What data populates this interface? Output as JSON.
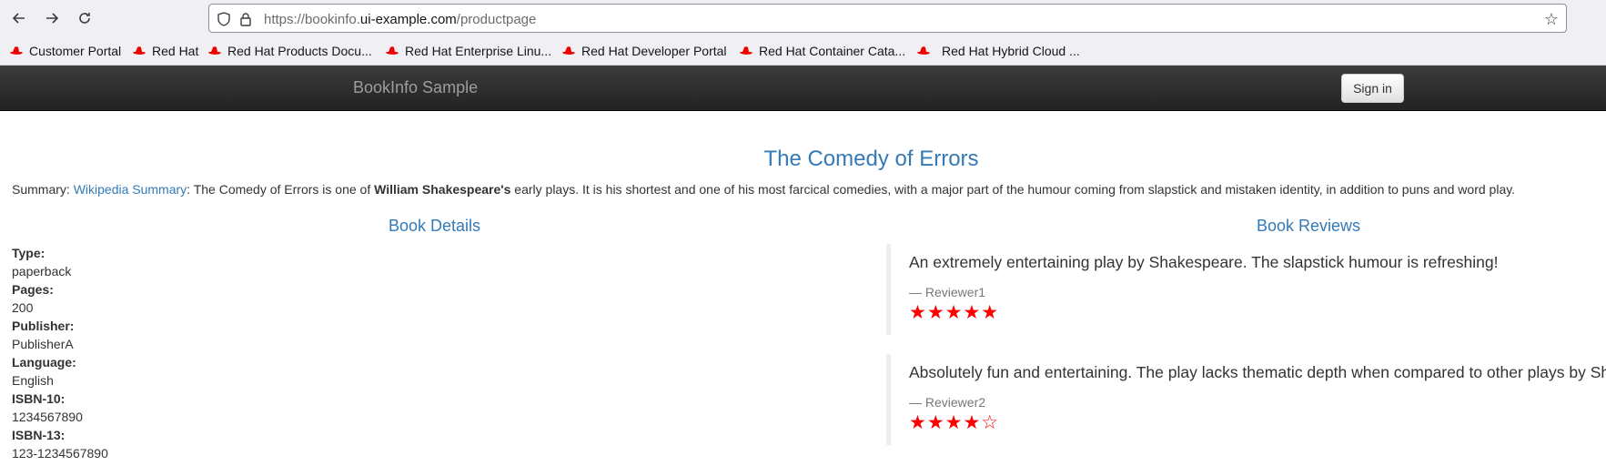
{
  "browser": {
    "url_prefix": "https://bookinfo.",
    "url_host": "ui-example.com",
    "url_path": "/productpage",
    "bookmarks": [
      "Customer Portal",
      "Red Hat",
      "Red Hat Products Docu...",
      "Red Hat Enterprise Linu...",
      "Red Hat Developer Portal",
      "Red Hat Container Cata...",
      "Red Hat Hybrid Cloud ..."
    ]
  },
  "navbar": {
    "brand": "BookInfo Sample",
    "signin_label": "Sign in"
  },
  "product": {
    "title": "The Comedy of Errors",
    "summary_label": "Summary: ",
    "summary_link": "Wikipedia Summary",
    "summary_pre": ": The Comedy of Errors is one of ",
    "summary_bold": "William Shakespeare's",
    "summary_post": " early plays. It is his shortest and one of his most farcical comedies, with a major part of the humour coming from slapstick and mistaken identity, in addition to puns and word play."
  },
  "details": {
    "heading": "Book Details",
    "items": [
      {
        "label": "Type:",
        "value": "paperback"
      },
      {
        "label": "Pages:",
        "value": "200"
      },
      {
        "label": "Publisher:",
        "value": "PublisherA"
      },
      {
        "label": "Language:",
        "value": "English"
      },
      {
        "label": "ISBN-10:",
        "value": "1234567890"
      },
      {
        "label": "ISBN-13:",
        "value": "123-1234567890"
      }
    ]
  },
  "reviews": {
    "heading": "Book Reviews",
    "items": [
      {
        "text": "An extremely entertaining play by Shakespeare. The slapstick humour is refreshing!",
        "reviewer": "— Reviewer1",
        "rating": 5,
        "stars": "★★★★★"
      },
      {
        "text": "Absolutely fun and entertaining. The play lacks thematic depth when compared to other plays by Shakespeare.",
        "reviewer": "— Reviewer2",
        "rating": 4,
        "stars": "★★★★☆"
      }
    ]
  },
  "colors": {
    "link": "#337ab7",
    "star": "#ff0000",
    "navbar": "#222222"
  }
}
